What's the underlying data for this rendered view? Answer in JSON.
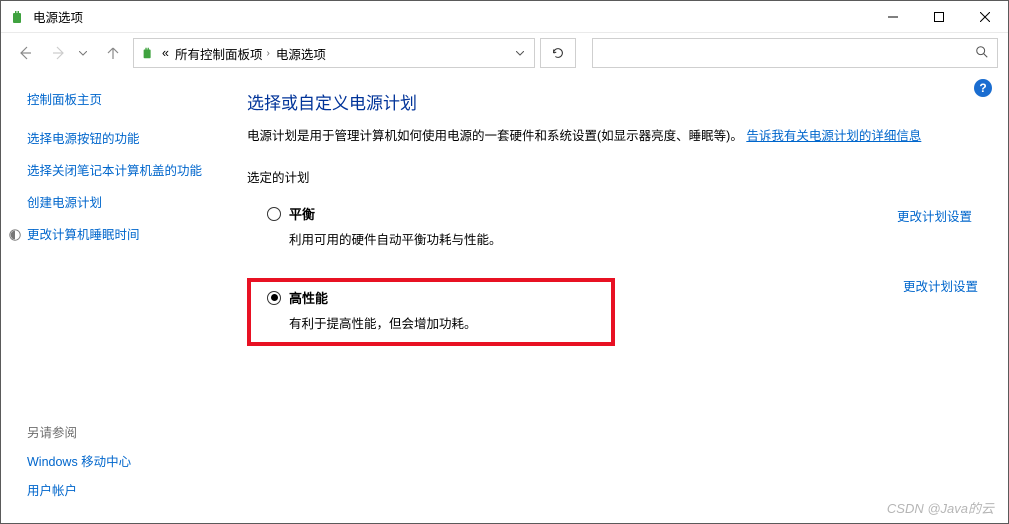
{
  "window": {
    "title": "电源选项"
  },
  "breadcrumb": {
    "root_icon": "battery-icon",
    "prefix": "«",
    "items": [
      "所有控制面板项",
      "电源选项"
    ]
  },
  "toolbar": {
    "back": "←",
    "forward": "→",
    "dropdown": "v",
    "up": "↑",
    "refresh": "↻",
    "search_icon": "🔍"
  },
  "search": {
    "placeholder": ""
  },
  "help_icon": "?",
  "sidebar": {
    "home": "控制面板主页",
    "items": [
      {
        "label": "选择电源按钮的功能"
      },
      {
        "label": "选择关闭笔记本计算机盖的功能"
      },
      {
        "label": "创建电源计划"
      },
      {
        "label": "更改计算机睡眠时间",
        "icon": "sleep-icon"
      }
    ],
    "see_also_label": "另请参阅",
    "see_also": [
      {
        "label": "Windows 移动中心"
      },
      {
        "label": "用户帐户"
      }
    ]
  },
  "main": {
    "heading": "选择或自定义电源计划",
    "description_pre": "电源计划是用于管理计算机如何使用电源的一套硬件和系统设置(如显示器亮度、睡眠等)。",
    "description_link": "告诉我有关电源计划的详细信息",
    "section_label": "选定的计划",
    "plans": [
      {
        "name": "平衡",
        "desc": "利用可用的硬件自动平衡功耗与性能。",
        "selected": false,
        "change_label": "更改计划设置"
      },
      {
        "name": "高性能",
        "desc": "有利于提高性能，但会增加功耗。",
        "selected": true,
        "change_label": "更改计划设置"
      }
    ]
  },
  "watermark": "CSDN @Java的云"
}
